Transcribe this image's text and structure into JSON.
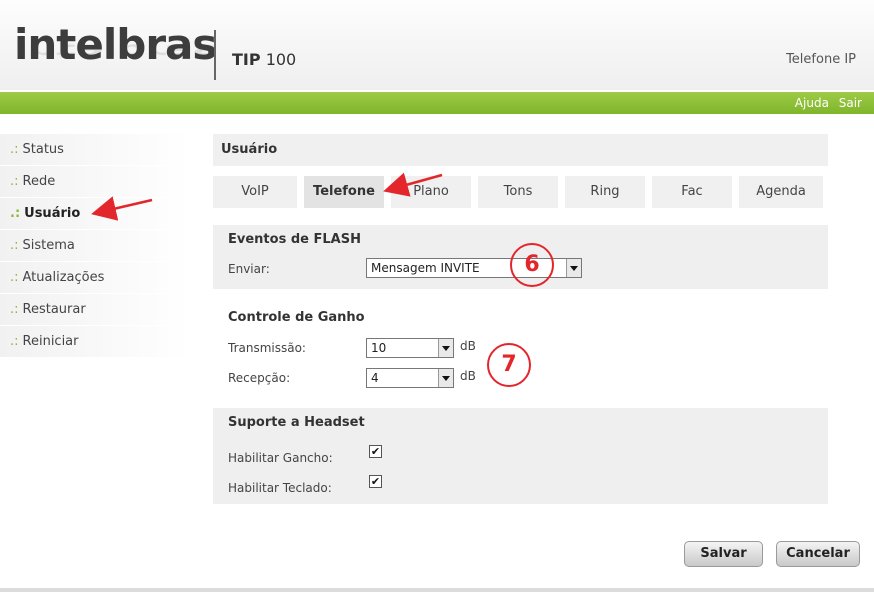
{
  "header": {
    "logo_text": "intelbras",
    "model_bold": "TIP",
    "model_number": "100",
    "product_label": "Telefone IP",
    "links": [
      "Ajuda",
      "Sair"
    ]
  },
  "sidebar": {
    "items": [
      {
        "label": "Status"
      },
      {
        "label": "Rede"
      },
      {
        "label": "Usuário"
      },
      {
        "label": "Sistema"
      },
      {
        "label": "Atualizações"
      },
      {
        "label": "Restaurar"
      },
      {
        "label": "Reiniciar"
      }
    ],
    "bullet": ".:"
  },
  "main": {
    "section_title": "Usuário",
    "tabs": [
      "VoIP",
      "Telefone",
      "Plano",
      "Tons",
      "Ring",
      "Fac",
      "Agenda"
    ],
    "active_tab": "Telefone",
    "flash": {
      "title": "Eventos de FLASH",
      "send_label": "Enviar:",
      "send_value": "Mensagem INVITE"
    },
    "gain": {
      "title": "Controle de Ganho",
      "tx_label": "Transmissão:",
      "tx_value": "10",
      "rx_label": "Recepção:",
      "rx_value": "4",
      "unit": "dB"
    },
    "headset": {
      "title": "Suporte a Headset",
      "hook_label": "Habilitar Gancho:",
      "hook_checked": true,
      "keypad_label": "Habilitar Teclado:",
      "keypad_checked": true,
      "check_glyph": "✔"
    },
    "buttons": {
      "save": "Salvar",
      "cancel": "Cancelar"
    }
  },
  "annotations": {
    "callout_6": "6",
    "callout_7": "7"
  },
  "colors": {
    "accent_green": "#8ab83a",
    "annotation_red": "#e3262b"
  }
}
